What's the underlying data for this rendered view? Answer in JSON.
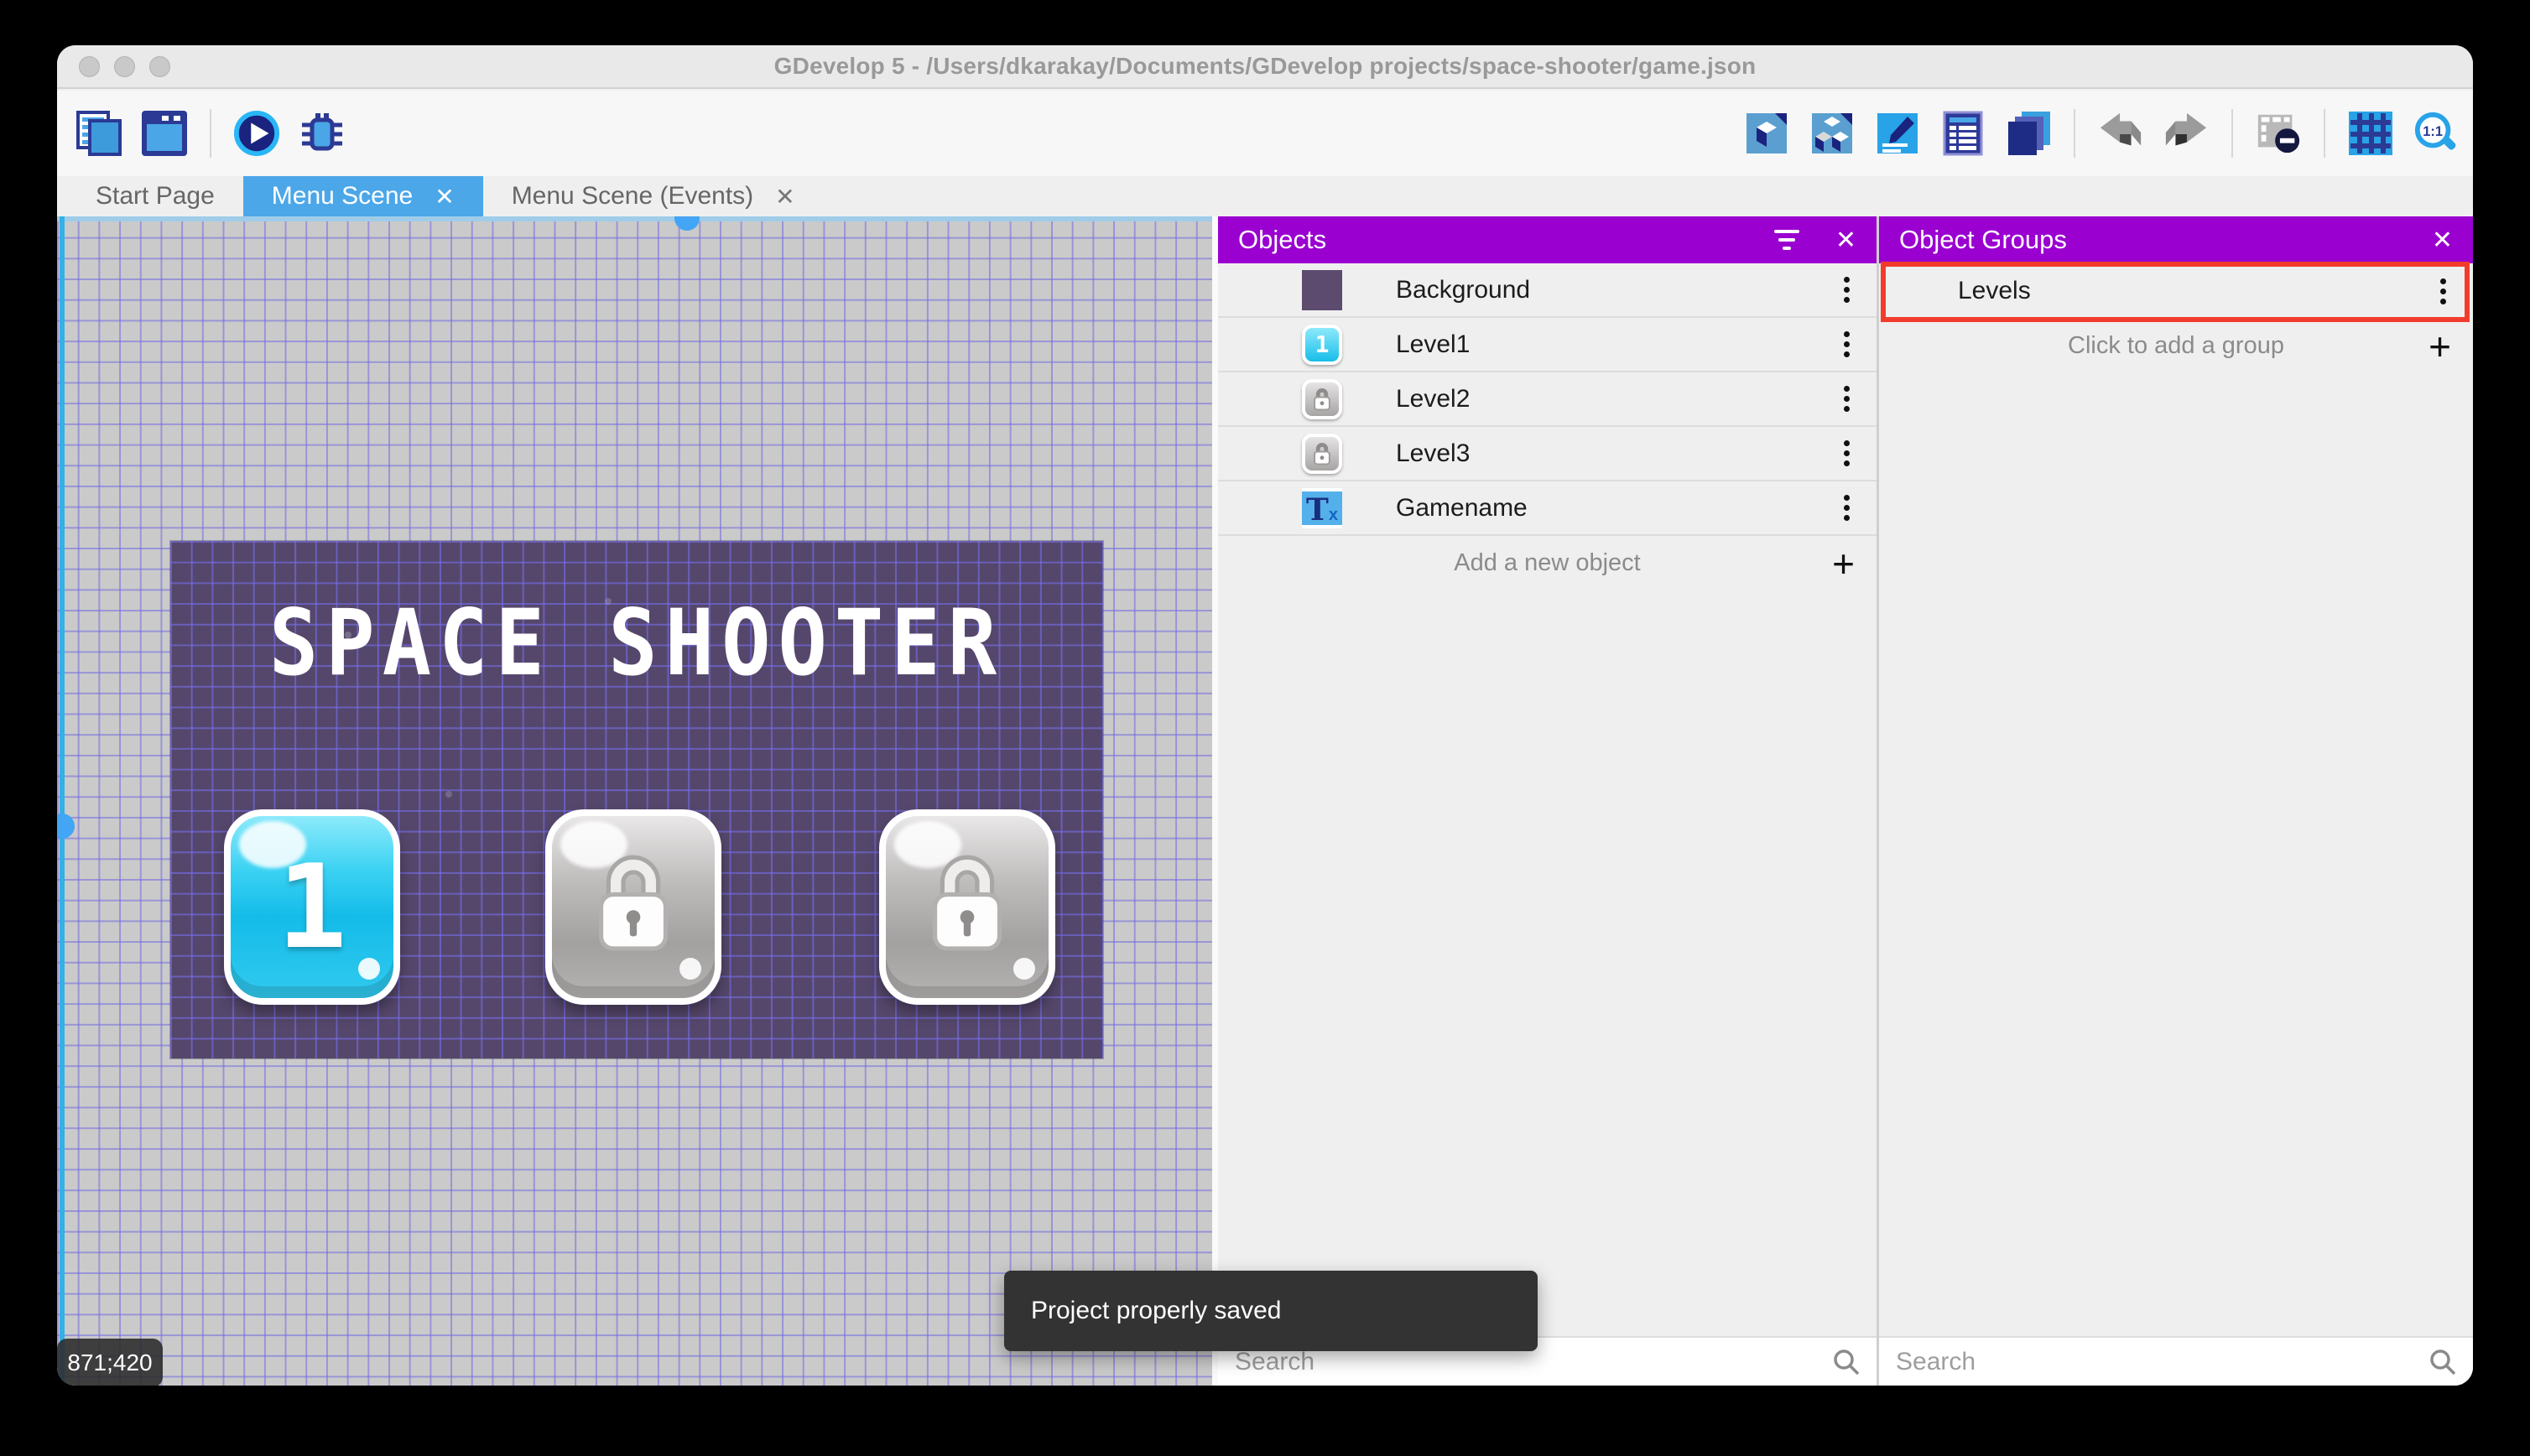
{
  "colors": {
    "accent_blue": "#42a5f5",
    "active_tab_blue": "#4ba7e8",
    "panel_header_purple": "#9a00d0",
    "annotation_red": "#f23c2b",
    "scene_purple": "#55476b",
    "canvas_gray": "#cacaca",
    "toast_bg": "#333333"
  },
  "glyphs": {
    "close": "✕",
    "plus": "+"
  },
  "window": {
    "title": "GDevelop 5 - /Users/dkarakay/Documents/GDevelop projects/space-shooter/game.json"
  },
  "toolbar": {
    "left_icons": [
      "project-manager-icon",
      "open-scene-icon",
      "play-icon",
      "debug-icon"
    ],
    "right_icons": [
      "add-object-icon",
      "object-groups-icon",
      "edit-scene-properties-icon",
      "events-sheet-icon",
      "instances-list-icon",
      "undo-icon",
      "redo-icon",
      "mask-icon",
      "grid-icon",
      "zoom-icon"
    ],
    "zoom_label": "1:1"
  },
  "tabs": [
    {
      "label": "Start Page",
      "active": false,
      "closable": false
    },
    {
      "label": "Menu Scene",
      "active": true,
      "closable": true
    },
    {
      "label": "Menu Scene (Events)",
      "active": false,
      "closable": true
    }
  ],
  "canvas": {
    "coordinates": "871;420"
  },
  "scene": {
    "title": "SPACE SHOOTER",
    "level_buttons": [
      {
        "label": "1",
        "locked": false
      },
      {
        "label": "",
        "locked": true
      },
      {
        "label": "",
        "locked": true
      }
    ]
  },
  "objects_panel": {
    "title": "Objects",
    "rows": [
      {
        "name": "Background",
        "thumb": "background-sprite"
      },
      {
        "name": "Level1",
        "thumb": "level1-button",
        "thumb_text": "1"
      },
      {
        "name": "Level2",
        "thumb": "locked-button"
      },
      {
        "name": "Level3",
        "thumb": "locked-button"
      },
      {
        "name": "Gamename",
        "thumb": "text-object",
        "thumb_text_main": "T",
        "thumb_text_sub": "x"
      }
    ],
    "add_label": "Add a new object",
    "search_placeholder": "Search"
  },
  "groups_panel": {
    "title": "Object Groups",
    "rows": [
      {
        "name": "Levels",
        "highlighted": true
      }
    ],
    "add_label": "Click to add a group",
    "search_placeholder": "Search"
  },
  "toast": {
    "message": "Project properly saved"
  }
}
